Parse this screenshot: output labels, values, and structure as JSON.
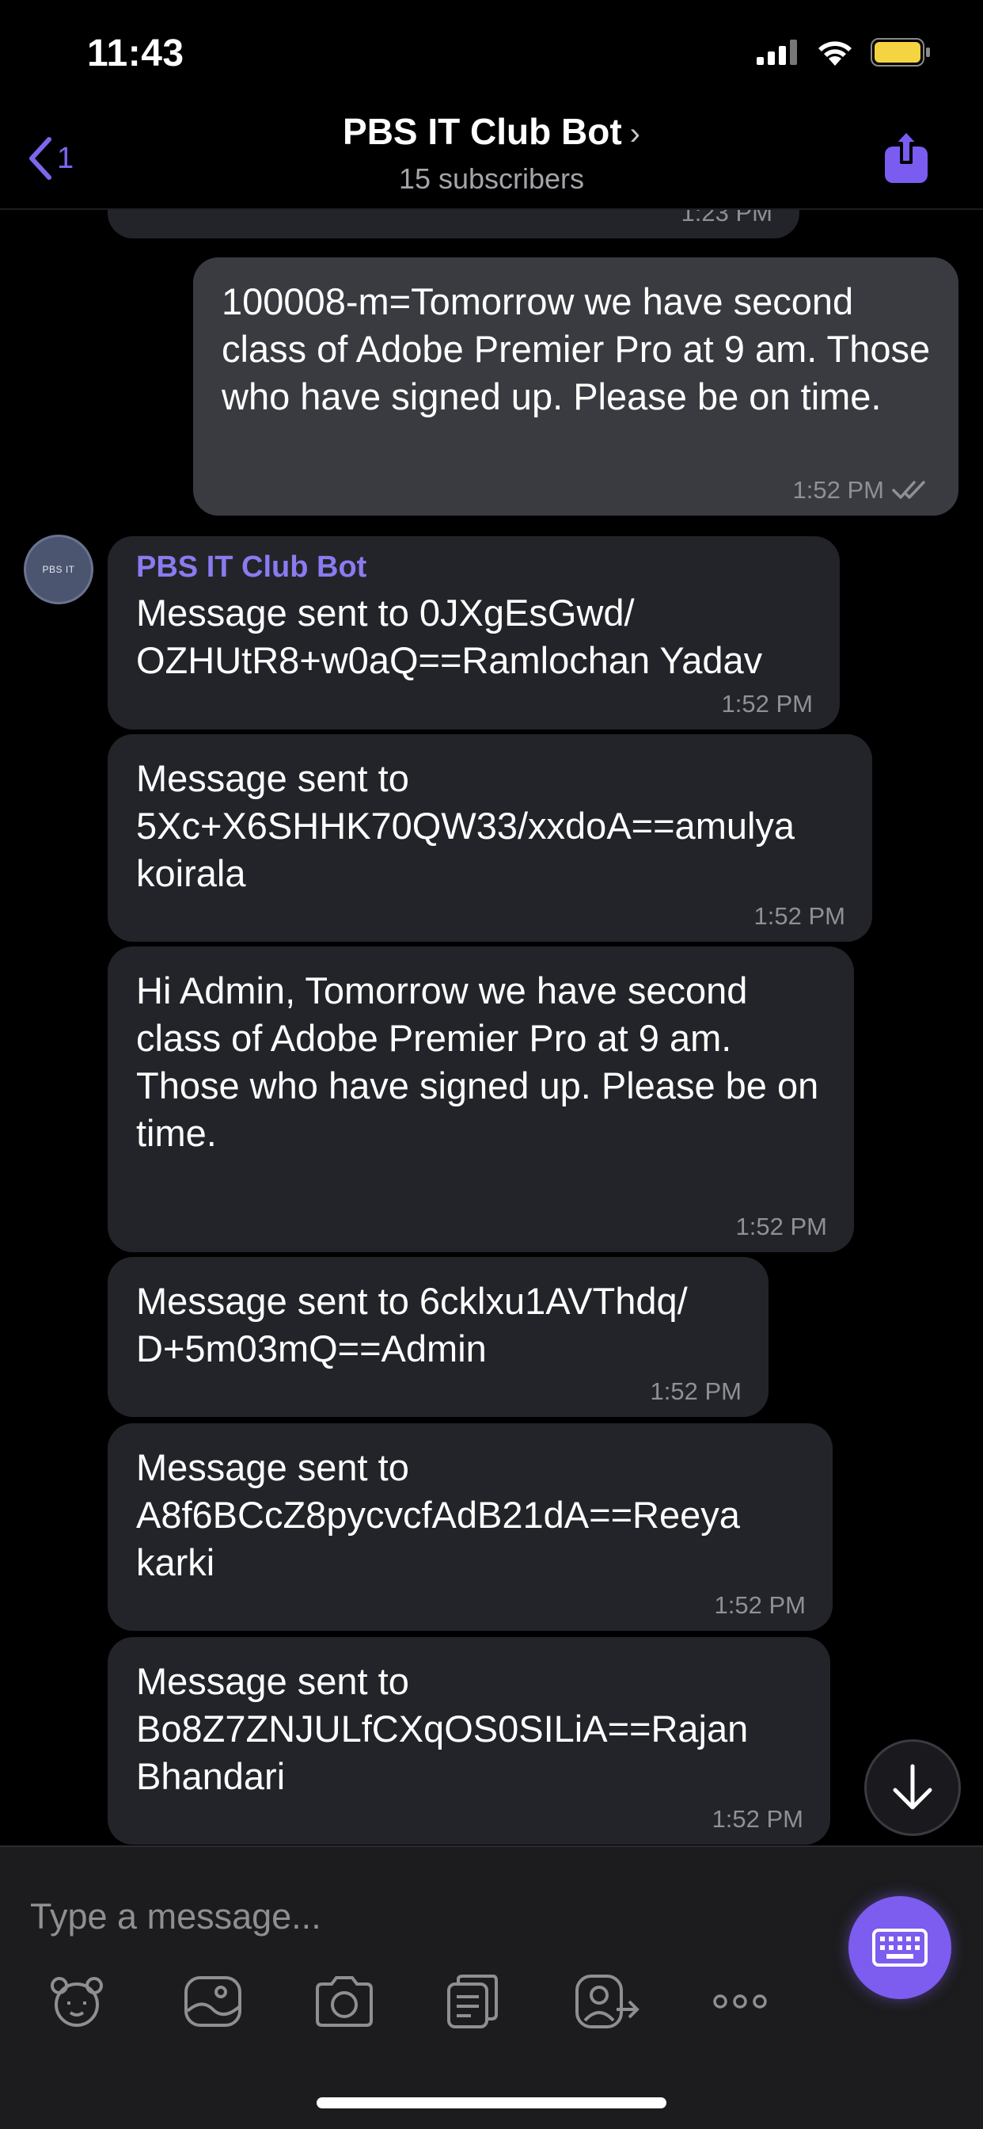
{
  "status_bar": {
    "time": "11:43"
  },
  "header": {
    "back_count": "1",
    "title": "PBS IT Club Bot",
    "subtitle": "15 subscribers"
  },
  "messages": [
    {
      "id": "m0",
      "direction": "incoming",
      "text": "",
      "time": "1:23 PM"
    },
    {
      "id": "m1",
      "direction": "outgoing",
      "text": "100008-m=Tomorrow we have second class of Adobe Premier Pro at 9 am. Those who have signed up. Please be on time.",
      "time": "1:52 PM",
      "status": "read"
    },
    {
      "id": "m2",
      "direction": "incoming",
      "sender": "PBS IT Club Bot",
      "text": "Message sent to 0JXgEsGwd/\nOZHUtR8+w0aQ==Ramlochan Yadav",
      "time": "1:52 PM"
    },
    {
      "id": "m3",
      "direction": "incoming",
      "text": "Message sent to\n5Xc+X6SHHK70QW33/xxdoA==amulya\nkoirala",
      "time": "1:52 PM"
    },
    {
      "id": "m4",
      "direction": "incoming",
      "text": "Hi Admin, Tomorrow we have second class of Adobe Premier Pro at 9 am. Those who have signed up. Please be on time.",
      "time": "1:52 PM"
    },
    {
      "id": "m5",
      "direction": "incoming",
      "text": "Message sent to 6cklxu1AVThdq/\nD+5m03mQ==Admin",
      "time": "1:52 PM"
    },
    {
      "id": "m6",
      "direction": "incoming",
      "text": "Message sent to\nA8f6BCcZ8pycvcfAdB21dA==Reeya\nkarki",
      "time": "1:52 PM"
    },
    {
      "id": "m7",
      "direction": "incoming",
      "text": "Message sent to\nBo8Z7ZNJULfCXqOS0SILiA==Rajan\nBhandari",
      "time": "1:52 PM"
    }
  ],
  "avatar": {
    "label": "PBS IT"
  },
  "composer": {
    "placeholder": "Type a message...",
    "tools": [
      "sticker-icon",
      "gallery-icon",
      "camera-icon",
      "notes-icon",
      "share-contact-icon",
      "more-icon"
    ]
  },
  "colors": {
    "accent": "#7d5cf0",
    "incoming_bubble": "#232429",
    "outgoing_bubble": "#3a3b40"
  }
}
